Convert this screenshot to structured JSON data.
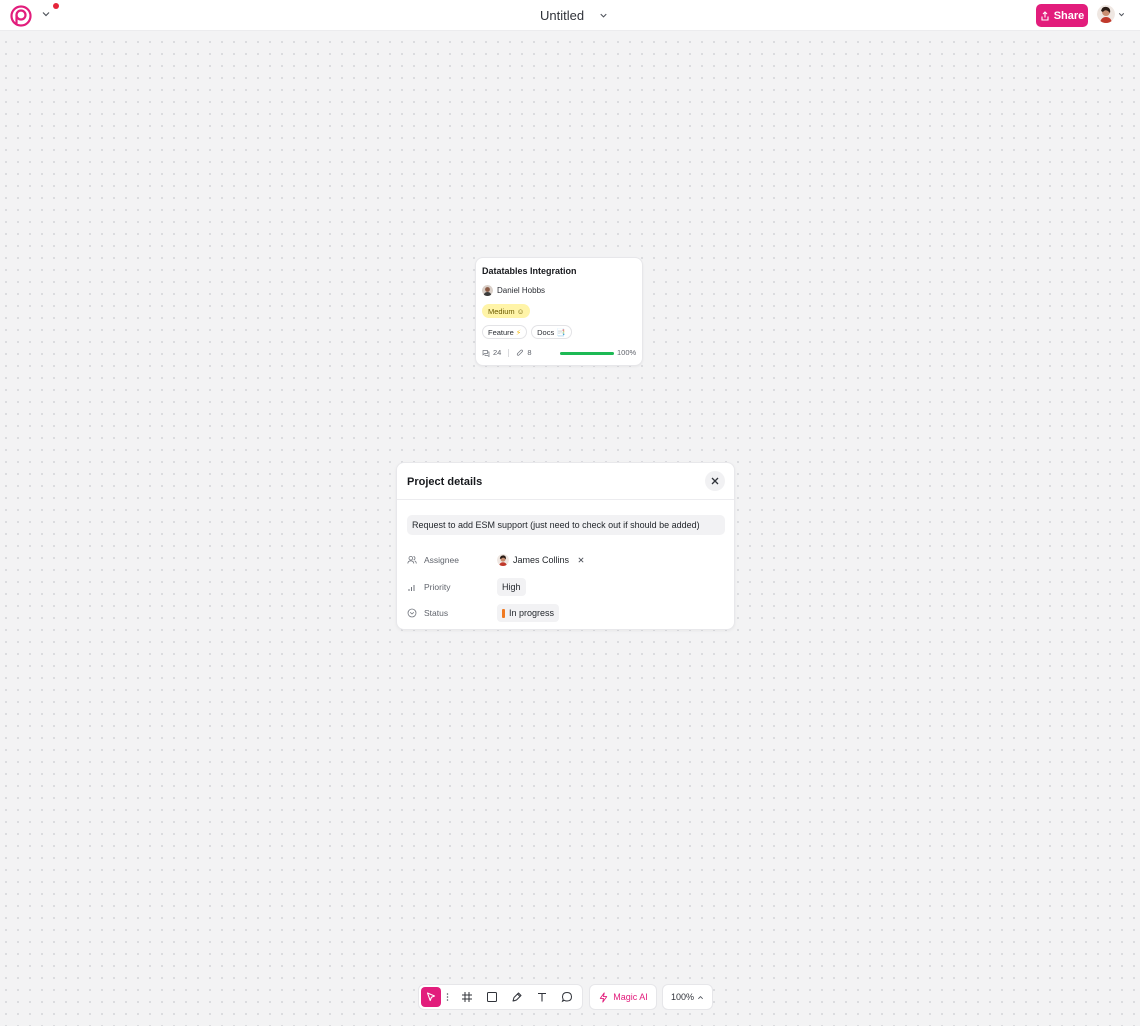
{
  "topbar": {
    "title": "Untitled",
    "share_label": "Share"
  },
  "card": {
    "title": "Datatables Integration",
    "assignee": "Daniel Hobbs",
    "priority": "Medium",
    "priority_emoji": "☺",
    "tags": [
      {
        "label": "Feature",
        "emoji": "⚡"
      },
      {
        "label": "Docs",
        "emoji": "📑"
      }
    ],
    "comments": "24",
    "attachments": "8",
    "progress": 100,
    "progress_label": "100%"
  },
  "panel": {
    "title": "Project details",
    "description": "Request to add ESM support (just need to check out if should be added)",
    "assignee_label": "Assignee",
    "assignee_value": "James Collins",
    "priority_label": "Priority",
    "priority_value": "High",
    "status_label": "Status",
    "status_value": "In progress",
    "status_color": "#f07a22"
  },
  "toolbar": {
    "tools": [
      "pointer-icon",
      "frame-icon",
      "rectangle-icon",
      "pen-icon",
      "text-icon",
      "comment-icon"
    ],
    "magic_label": "Magic AI",
    "zoom_label": "100%"
  },
  "colors": {
    "accent": "#e21d7c",
    "progress": "#1db954",
    "medium_pill": "#fff4a8"
  }
}
